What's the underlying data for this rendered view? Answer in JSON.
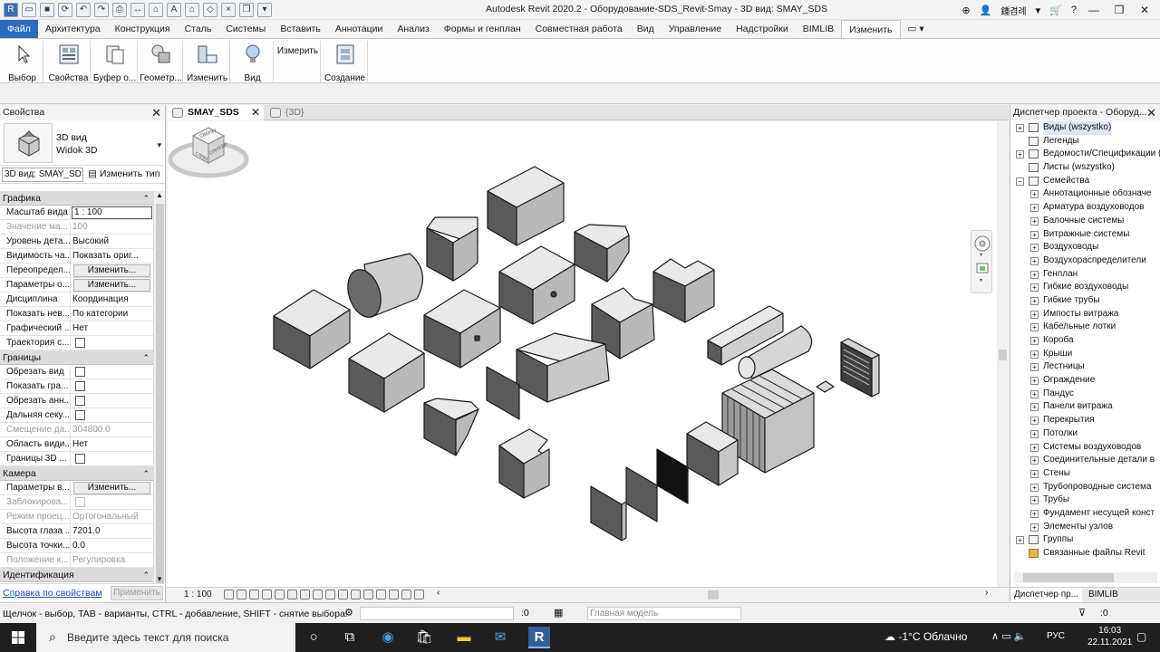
{
  "window": {
    "title": "Autodesk Revit 2020.2 - Оборудование-SDS_Revit-Smay - 3D вид: SMAY_SDS",
    "user": "鍾겸례",
    "qat_icons": [
      "revit-r-icon",
      "open-icon",
      "save-icon",
      "sync-icon",
      "undo-icon",
      "redo-icon",
      "print-icon",
      "measure-icon",
      "tag-icon",
      "text-icon",
      "3d-icon",
      "sections-icon",
      "close-windows-icon",
      "switch-windows-icon",
      "qat-dropdown-icon"
    ]
  },
  "ribbon": {
    "tabs": [
      "Файл",
      "Архитектура",
      "Конструкция",
      "Сталь",
      "Системы",
      "Вставить",
      "Аннотации",
      "Анализ",
      "Формы и генплан",
      "Совместная работа",
      "Вид",
      "Управление",
      "Надстройки",
      "BIMLIB",
      "Изменить"
    ],
    "active_tab": "Изменить",
    "groups": [
      {
        "label": "Выбор",
        "icon": "cursor-icon"
      },
      {
        "label": "Свойства",
        "icon": "properties-icon"
      },
      {
        "label": "Буфер о...",
        "icon": "clipboard-icon"
      },
      {
        "label": "Геометр...",
        "icon": "geometry-icon"
      },
      {
        "label": "Изменить",
        "icon": "modify-icon"
      },
      {
        "label": "Вид",
        "icon": "view-bulb-icon"
      },
      {
        "label": "Измерить",
        "icon": "measure-panel-icon"
      },
      {
        "label": "Создание",
        "icon": "create-icon"
      }
    ]
  },
  "properties": {
    "title": "Свойства",
    "type_line1": "3D вид",
    "type_line2": "Widok 3D",
    "filter": "3D вид: SMAY_SDS",
    "edit_type": "Изменить тип",
    "sections": [
      {
        "name": "Графика",
        "rows": [
          {
            "name": "Масштаб вида",
            "value": "1 : 100",
            "kind": "input"
          },
          {
            "name": "Значение ма...",
            "value": "100",
            "kind": "dim"
          },
          {
            "name": "Уровень дета...",
            "value": "Высокий",
            "kind": "text"
          },
          {
            "name": "Видимость ча...",
            "value": "Показать ориг...",
            "kind": "text"
          },
          {
            "name": "Переопредел...",
            "value": "Изменить...",
            "kind": "button"
          },
          {
            "name": "Параметры о...",
            "value": "Изменить...",
            "kind": "button"
          },
          {
            "name": "Дисциплина",
            "value": "Координация",
            "kind": "text"
          },
          {
            "name": "Показать нев...",
            "value": "По категории",
            "kind": "text"
          },
          {
            "name": "Графический ...",
            "value": "Нет",
            "kind": "text"
          },
          {
            "name": "Траектория с...",
            "value": "",
            "kind": "check"
          }
        ]
      },
      {
        "name": "Границы",
        "rows": [
          {
            "name": "Обрезать вид",
            "value": "",
            "kind": "check"
          },
          {
            "name": "Показать гра...",
            "value": "",
            "kind": "check"
          },
          {
            "name": "Обрезать анн...",
            "value": "",
            "kind": "check"
          },
          {
            "name": "Дальняя секу...",
            "value": "",
            "kind": "check"
          },
          {
            "name": "Смещение да...",
            "value": "304800.0",
            "kind": "dim"
          },
          {
            "name": "Область види...",
            "value": "Нет",
            "kind": "text"
          },
          {
            "name": "Границы 3D ...",
            "value": "",
            "kind": "check"
          }
        ]
      },
      {
        "name": "Камера",
        "rows": [
          {
            "name": "Параметры в...",
            "value": "Изменить...",
            "kind": "button"
          },
          {
            "name": "Заблокирова...",
            "value": "",
            "kind": "dimcheck"
          },
          {
            "name": "Режим проец...",
            "value": "Ортогональный",
            "kind": "dim"
          },
          {
            "name": "Высота глаза ...",
            "value": "7201.0",
            "kind": "text"
          },
          {
            "name": "Высота точки...",
            "value": "0.0",
            "kind": "text"
          },
          {
            "name": "Положение к...",
            "value": "Регулировка",
            "kind": "dim"
          }
        ]
      },
      {
        "name": "Идентификация",
        "rows": []
      }
    ],
    "help_link": "Справка по свойствам",
    "apply": "Применить"
  },
  "view_tabs": [
    {
      "label": "SMAY_SDS",
      "active": true
    },
    {
      "label": "{3D}",
      "active": false
    }
  ],
  "viewcube": {
    "top": "СВЕРХУ",
    "front": "СПЕРЕДИ",
    "left": "СЛЕВА"
  },
  "view_control": {
    "scale": "1 : 100"
  },
  "browser": {
    "title": "Диспетчер проекта - Оборуд...",
    "nodes": [
      {
        "label": "Виды (wszystko)",
        "level": 0,
        "expander": "+",
        "selected": true
      },
      {
        "label": "Легенды",
        "level": 0,
        "expander": ""
      },
      {
        "label": "Ведомости/Спецификации (",
        "level": 0,
        "expander": "+"
      },
      {
        "label": "Листы (wszystko)",
        "level": 0,
        "expander": ""
      },
      {
        "label": "Семейства",
        "level": 0,
        "expander": "-"
      },
      {
        "label": "Аннотационные обозначе",
        "level": 1,
        "expander": "+"
      },
      {
        "label": "Арматура воздуховодов",
        "level": 1,
        "expander": "+"
      },
      {
        "label": "Балочные системы",
        "level": 1,
        "expander": "+"
      },
      {
        "label": "Витражные системы",
        "level": 1,
        "expander": "+"
      },
      {
        "label": "Воздуховоды",
        "level": 1,
        "expander": "+"
      },
      {
        "label": "Воздухораспределители",
        "level": 1,
        "expander": "+"
      },
      {
        "label": "Генплан",
        "level": 1,
        "expander": "+"
      },
      {
        "label": "Гибкие воздуховоды",
        "level": 1,
        "expander": "+"
      },
      {
        "label": "Гибкие трубы",
        "level": 1,
        "expander": "+"
      },
      {
        "label": "Импосты витража",
        "level": 1,
        "expander": "+"
      },
      {
        "label": "Кабельные лотки",
        "level": 1,
        "expander": "+"
      },
      {
        "label": "Короба",
        "level": 1,
        "expander": "+"
      },
      {
        "label": "Крыши",
        "level": 1,
        "expander": "+"
      },
      {
        "label": "Лестницы",
        "level": 1,
        "expander": "+"
      },
      {
        "label": "Ограждение",
        "level": 1,
        "expander": "+"
      },
      {
        "label": "Пандус",
        "level": 1,
        "expander": "+"
      },
      {
        "label": "Панели витража",
        "level": 1,
        "expander": "+"
      },
      {
        "label": "Перекрытия",
        "level": 1,
        "expander": "+"
      },
      {
        "label": "Потолки",
        "level": 1,
        "expander": "+"
      },
      {
        "label": "Системы воздуховодов",
        "level": 1,
        "expander": "+"
      },
      {
        "label": "Соединительные детали в",
        "level": 1,
        "expander": "+"
      },
      {
        "label": "Стены",
        "level": 1,
        "expander": "+"
      },
      {
        "label": "Трубопроводные система",
        "level": 1,
        "expander": "+"
      },
      {
        "label": "Трубы",
        "level": 1,
        "expander": "+"
      },
      {
        "label": "Фундамент несущей конст",
        "level": 1,
        "expander": "+"
      },
      {
        "label": "Элементы узлов",
        "level": 1,
        "expander": "+"
      },
      {
        "label": "Группы",
        "level": 0,
        "expander": "+"
      },
      {
        "label": "Связанные файлы Revit",
        "level": 0,
        "expander": ""
      }
    ],
    "tabs": [
      "Диспетчер пр...",
      "BIMLIB"
    ]
  },
  "statusbar": {
    "text": "Щелчок - выбор, TAB - варианты, CTRL - добавление, SHIFT - снятие выбора.",
    "zero": ":0",
    "model": "Главная модель",
    "right_zero": ":0"
  },
  "taskbar": {
    "search_placeholder": "Введите здесь текст для поиска",
    "weather": "-1°C Облачно",
    "lang": "РУС",
    "time": "16:03",
    "date": "22.11.2021"
  },
  "colors": {
    "file_tab": "#2b6cc0",
    "selection": "#dbe7f6",
    "taskbar": "#1f1f1f"
  }
}
